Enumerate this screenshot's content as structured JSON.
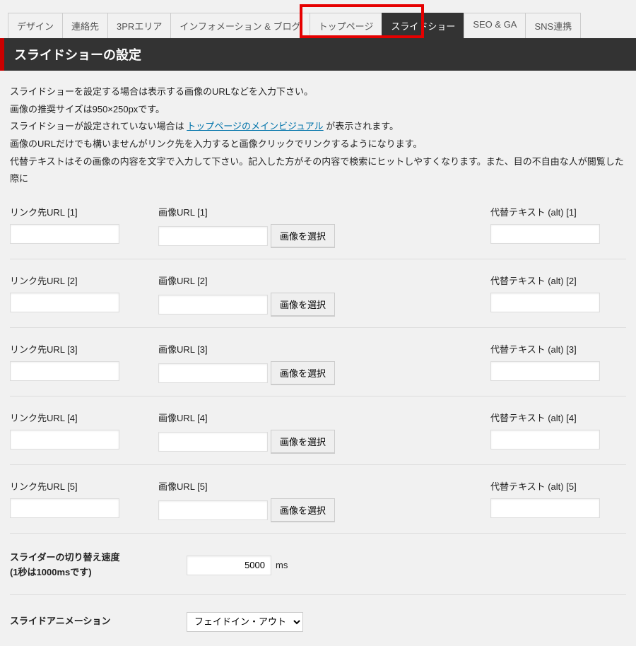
{
  "tabs": [
    {
      "label": "デザイン"
    },
    {
      "label": "連絡先"
    },
    {
      "label": "3PRエリア"
    },
    {
      "label": "インフォメーション & ブログ"
    },
    {
      "label": "トップページ"
    },
    {
      "label": "スライドショー",
      "active": true
    },
    {
      "label": "SEO & GA"
    },
    {
      "label": "SNS連携"
    }
  ],
  "section_title": "スライドショーの設定",
  "description": {
    "line1": "スライドショーを設定する場合は表示する画像のURLなどを入力下さい。",
    "line2": "画像の推奨サイズは950×250pxです。",
    "line3_a": "スライドショーが設定されていない場合は ",
    "line3_link": "トップページのメインビジュアル",
    "line3_b": " が表示されます。",
    "line4": "画像のURLだけでも構いませんがリンク先を入力すると画像クリックでリンクするようになります。",
    "line5": "代替テキストはその画像の内容を文字で入力して下さい。記入した方がその内容で検索にヒットしやすくなります。また、目の不自由な人が閲覧した際に"
  },
  "labels": {
    "link_url": "リンク先URL",
    "image_url": "画像URL",
    "alt_text": "代替テキスト (alt)",
    "select_image": "画像を選択"
  },
  "rows": [
    {
      "idx": "[1]"
    },
    {
      "idx": "[2]"
    },
    {
      "idx": "[3]"
    },
    {
      "idx": "[4]"
    },
    {
      "idx": "[5]"
    }
  ],
  "slider_speed": {
    "label": "スライダーの切り替え速度",
    "sublabel": "(1秒は1000msです)",
    "value": "5000",
    "unit": "ms"
  },
  "animation": {
    "label": "スライドアニメーション",
    "selected": "フェイドイン・アウト"
  }
}
